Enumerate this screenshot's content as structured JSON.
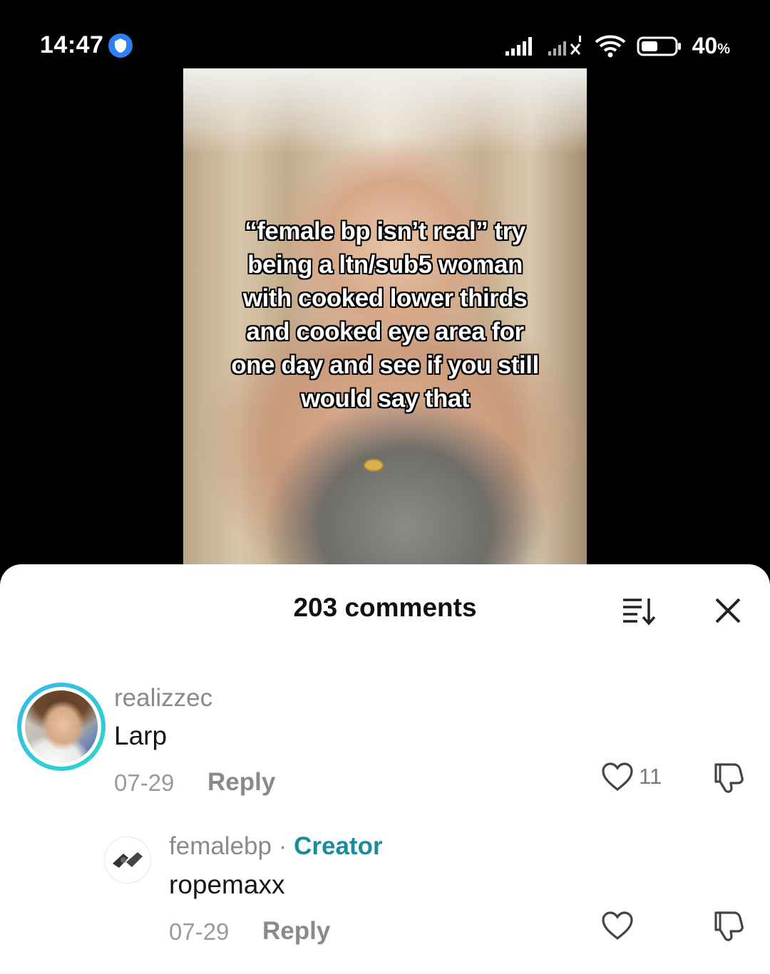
{
  "status_bar": {
    "time": "14:47",
    "battery_percent": "40",
    "battery_unit": "%",
    "icons": [
      "vpn-icon",
      "signal-icon",
      "signal-2-icon",
      "wifi-icon",
      "battery-icon"
    ]
  },
  "video": {
    "caption_lines": [
      "“female bp isn’t real” try",
      "being a ltn/sub5 woman",
      "with cooked lower thirds",
      "and cooked eye area for",
      "one day and see if you still",
      "would say that"
    ]
  },
  "comments_panel": {
    "title": "203 comments",
    "sort_icon": "sort-icon",
    "close_icon": "close-icon",
    "comments": [
      {
        "username": "realizzec",
        "text": "Larp",
        "date": "07-29",
        "reply_label": "Reply",
        "like_count": "11"
      }
    ],
    "replies": [
      {
        "username": "femalebp",
        "separator": " · ",
        "badge": "Creator",
        "text": "ropemaxx",
        "date": "07-29",
        "reply_label": "Reply"
      }
    ]
  },
  "colors": {
    "creator_badge": "#1a8c9c",
    "avatar_ring_start": "#35b8f0",
    "avatar_ring_end": "#2fd7c4",
    "vpn_badge": "#2f7ff5"
  }
}
